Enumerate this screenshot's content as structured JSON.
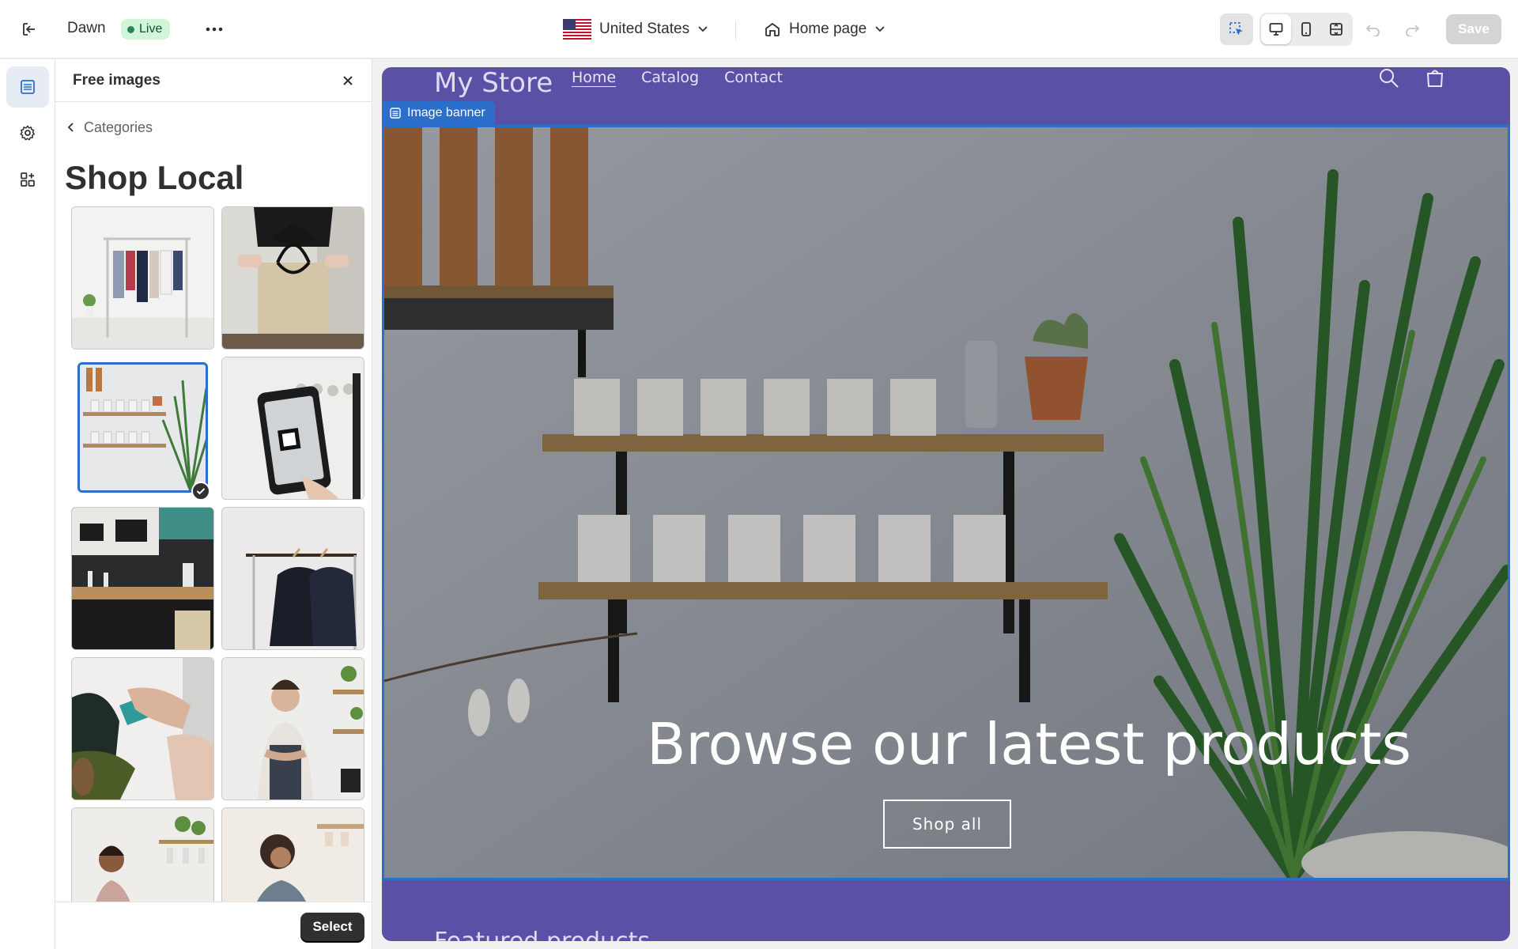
{
  "topbar": {
    "theme_name": "Dawn",
    "status": "Live",
    "country": "United States",
    "page": "Home page",
    "save_label": "Save"
  },
  "panel": {
    "title": "Free images",
    "breadcrumb": "Categories",
    "category_title": "Shop Local",
    "select_label": "Select",
    "images": [
      {
        "name": "clothing-rack"
      },
      {
        "name": "gift-bag"
      },
      {
        "name": "candle-shelves",
        "selected": true
      },
      {
        "name": "qr-code-phone"
      },
      {
        "name": "coffee-shop-interior"
      },
      {
        "name": "hanging-shirts"
      },
      {
        "name": "card-payment"
      },
      {
        "name": "shop-owner"
      },
      {
        "name": "woman-shopkeeper"
      },
      {
        "name": "woman-browsing"
      }
    ]
  },
  "preview": {
    "store_name": "My Store",
    "nav": [
      "Home",
      "Catalog",
      "Contact"
    ],
    "section_tag": "Image banner",
    "headline": "Browse our latest products",
    "cta": "Shop all",
    "next_section": "Featured products"
  },
  "colors": {
    "accent": "#2c6ecb",
    "store_bg": "#5a50a6",
    "live_badge": "#d1f5d9"
  }
}
